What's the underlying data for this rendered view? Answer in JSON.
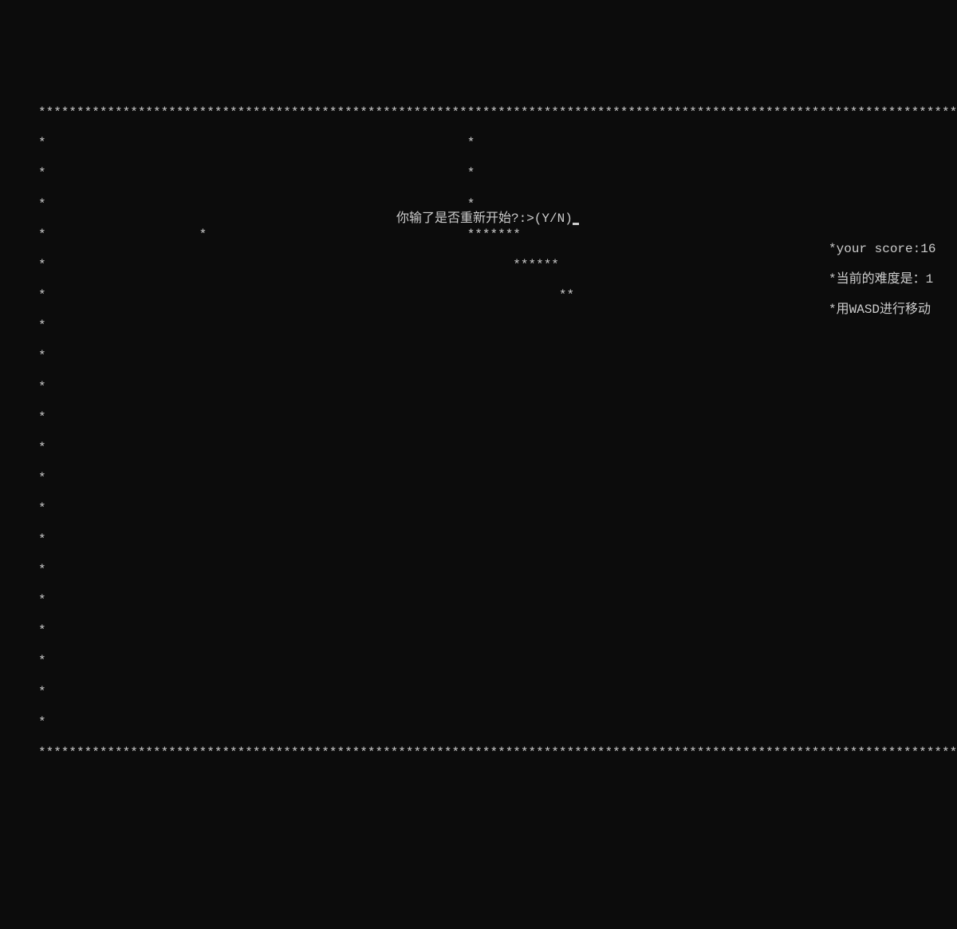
{
  "game": {
    "border_char": "*",
    "width_chars": 124,
    "height_rows": 24,
    "obstacle_at": {
      "row": 5,
      "col": 21
    },
    "snake_rows": [
      {
        "row": 5,
        "content": "*******",
        "col": 55
      },
      {
        "row": 6,
        "content": "******",
        "col": 61
      },
      {
        "row": 7,
        "content": "**",
        "col": 67
      }
    ]
  },
  "prompt": {
    "text": "你输了是否重新开始?:>(Y/N)"
  },
  "sidebar": {
    "score_label": "your score:",
    "score_value": "16",
    "difficulty_label": "当前的难度是：",
    "difficulty_value": "1",
    "controls_hint": "用WASD进行移动"
  },
  "chart_data": {
    "type": "game-state",
    "game": "snake",
    "state": "game_over",
    "score": 16,
    "difficulty": 1,
    "controls": "WASD",
    "restart_prompt": "Y/N"
  }
}
